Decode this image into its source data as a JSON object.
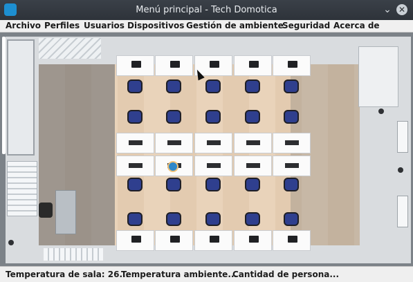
{
  "window": {
    "title": "Menú principal - Tech Domotica",
    "icon": "home-app-icon",
    "minimize_glyph": "⌄",
    "close_glyph": "✕"
  },
  "menu": {
    "items": [
      "Archivo",
      "Perfiles",
      "Usuarios",
      "Dispositivos",
      "Gestión de ambiente",
      "Seguridad",
      "Acerca de"
    ]
  },
  "room": {
    "floor_color": "#e9d3ba",
    "desk_color": "#fbfbfb",
    "chair_color": "#2f3f8e",
    "person_color": "#2e87c9",
    "desk_rows": 4,
    "desks_per_row": 5,
    "chair_rows": 4
  },
  "status": {
    "room_temperature": "Temperatura de sala: 26...",
    "ambient_temperature": "Temperatura ambiente...",
    "people_count": "Cantidad de persona..."
  }
}
